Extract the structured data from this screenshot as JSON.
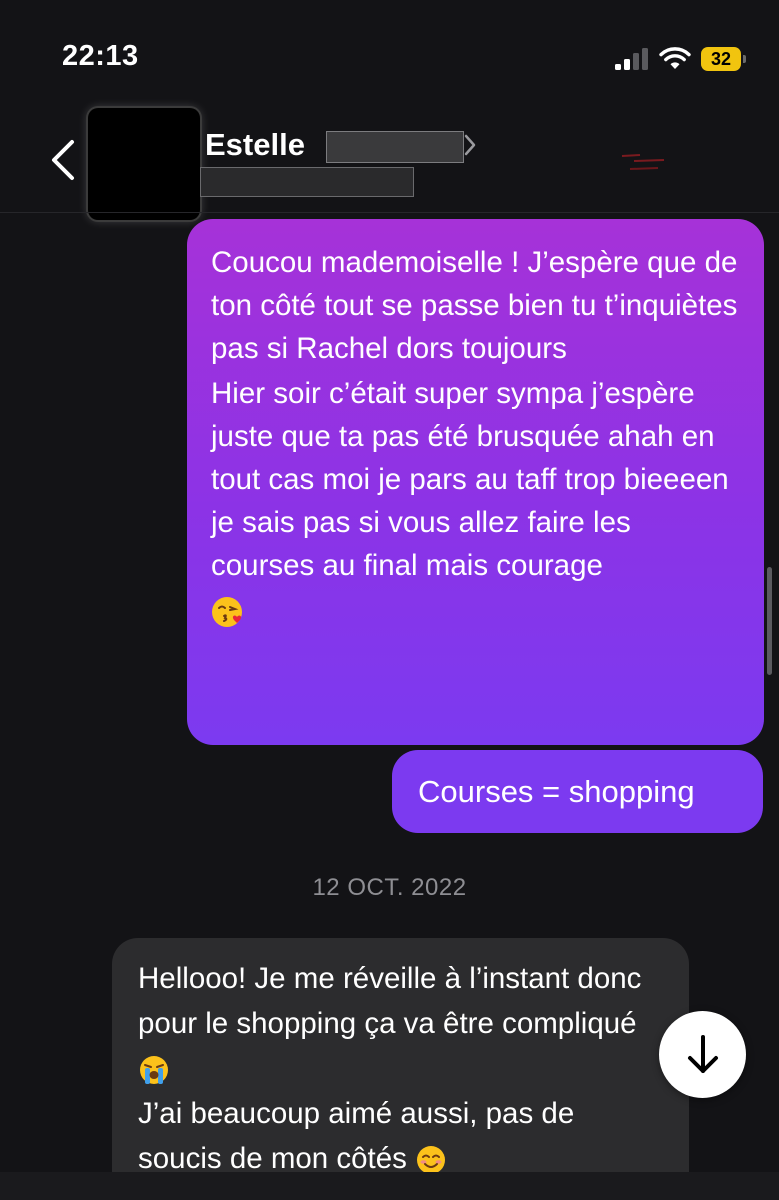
{
  "status_bar": {
    "time": "22:13",
    "battery": "32",
    "battery_color": "#f1c40f"
  },
  "header": {
    "contact_name": "Estelle",
    "back_icon": "chevron-left-icon",
    "chevron_icon": "chevron-right-icon"
  },
  "messages": {
    "sent_1": {
      "paragraph_1": "Coucou mademoiselle ! J’espère que de ton côté tout se passe bien tu t’inquiètes pas si Rachel dors toujours",
      "paragraph_2": "Hier soir c’était super sympa j’espère juste que ta pas été brusquée ahah en tout cas moi je pars au taff trop bieeeen je sais pas si vous allez faire les courses au final mais courage",
      "emoji": "face-blowing-a-kiss",
      "color": "#8c33e6"
    },
    "sent_2": {
      "text": "Courses = shopping",
      "color": "#7c3af0"
    },
    "date_separator": "12 OCT. 2022",
    "received_1": {
      "paragraph_1": "Hellooo! Je me réveille à l’instant donc pour le shopping ça va être compliqué",
      "emoji_1": "loudly-crying-face",
      "paragraph_2": "J’ai beaucoup aimé aussi, pas de soucis de mon côtés",
      "emoji_2": "smiling-face",
      "color": "#2c2c2e"
    }
  },
  "scroll_down": {
    "icon": "arrow-down-icon"
  }
}
